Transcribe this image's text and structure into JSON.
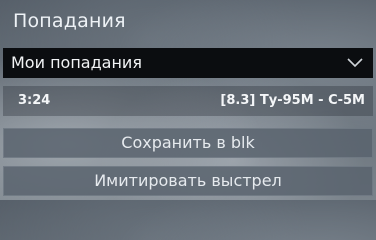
{
  "panel": {
    "title": "Попадания"
  },
  "dropdown": {
    "selected": "Мои попадания",
    "icon": "chevron-down-icon"
  },
  "hits": [
    {
      "time": "3:24",
      "target": "[8.3] Ту-95М - С-5М"
    }
  ],
  "buttons": {
    "save_label": "Сохранить в blk",
    "simulate_label": "Имитировать выстрел"
  }
}
